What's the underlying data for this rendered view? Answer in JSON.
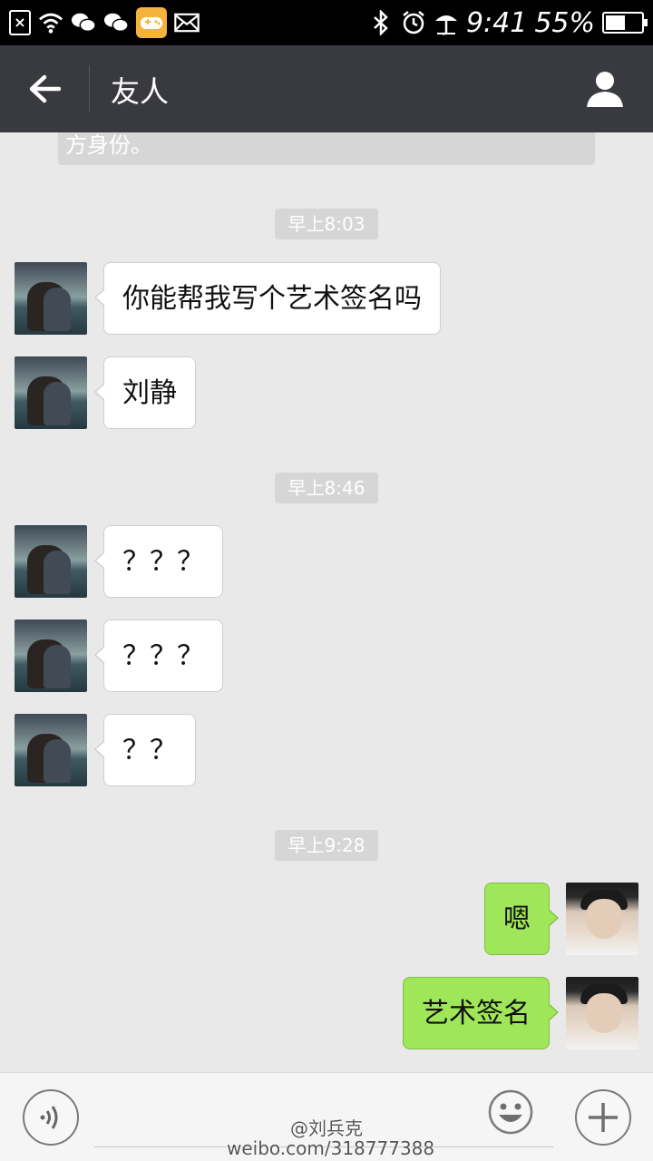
{
  "status_bar": {
    "sim_icon": "sim-missing-icon",
    "wifi_icon": "wifi-icon",
    "wechat_icons": [
      "wechat-icon",
      "wechat-icon"
    ],
    "game_icon": "gamepad-icon",
    "mail_icon": "envelope-icon",
    "bluetooth_icon": "bluetooth-icon",
    "alarm_icon": "alarm-icon",
    "time": "9:41",
    "battery_percent": "55%",
    "battery_level": 0.55
  },
  "header": {
    "title": "友人",
    "back_icon": "arrow-left-icon",
    "profile_icon": "person-icon",
    "background": "#393a3f"
  },
  "chat": {
    "system_notice": "方身份。",
    "timestamps": [
      "早上8:03",
      "早上8:46",
      "早上9:28"
    ],
    "messages": [
      {
        "side": "in",
        "text": "你能帮我写个艺术签名吗"
      },
      {
        "side": "in",
        "text": "刘静"
      },
      {
        "side": "in",
        "text": "？？？"
      },
      {
        "side": "in",
        "text": "？？？"
      },
      {
        "side": "in",
        "text": "？？"
      },
      {
        "side": "out",
        "text": "嗯"
      },
      {
        "side": "out",
        "text": "艺术签名"
      }
    ],
    "incoming_bubble_color": "#ffffff",
    "outgoing_bubble_color": "#9fe658"
  },
  "input_bar": {
    "voice_icon": "voice-icon",
    "emoji_icon": "smiley-icon",
    "plus_icon": "plus-icon",
    "watermark_line1": "@刘兵克",
    "watermark_line2": "weibo.com/318777388"
  }
}
